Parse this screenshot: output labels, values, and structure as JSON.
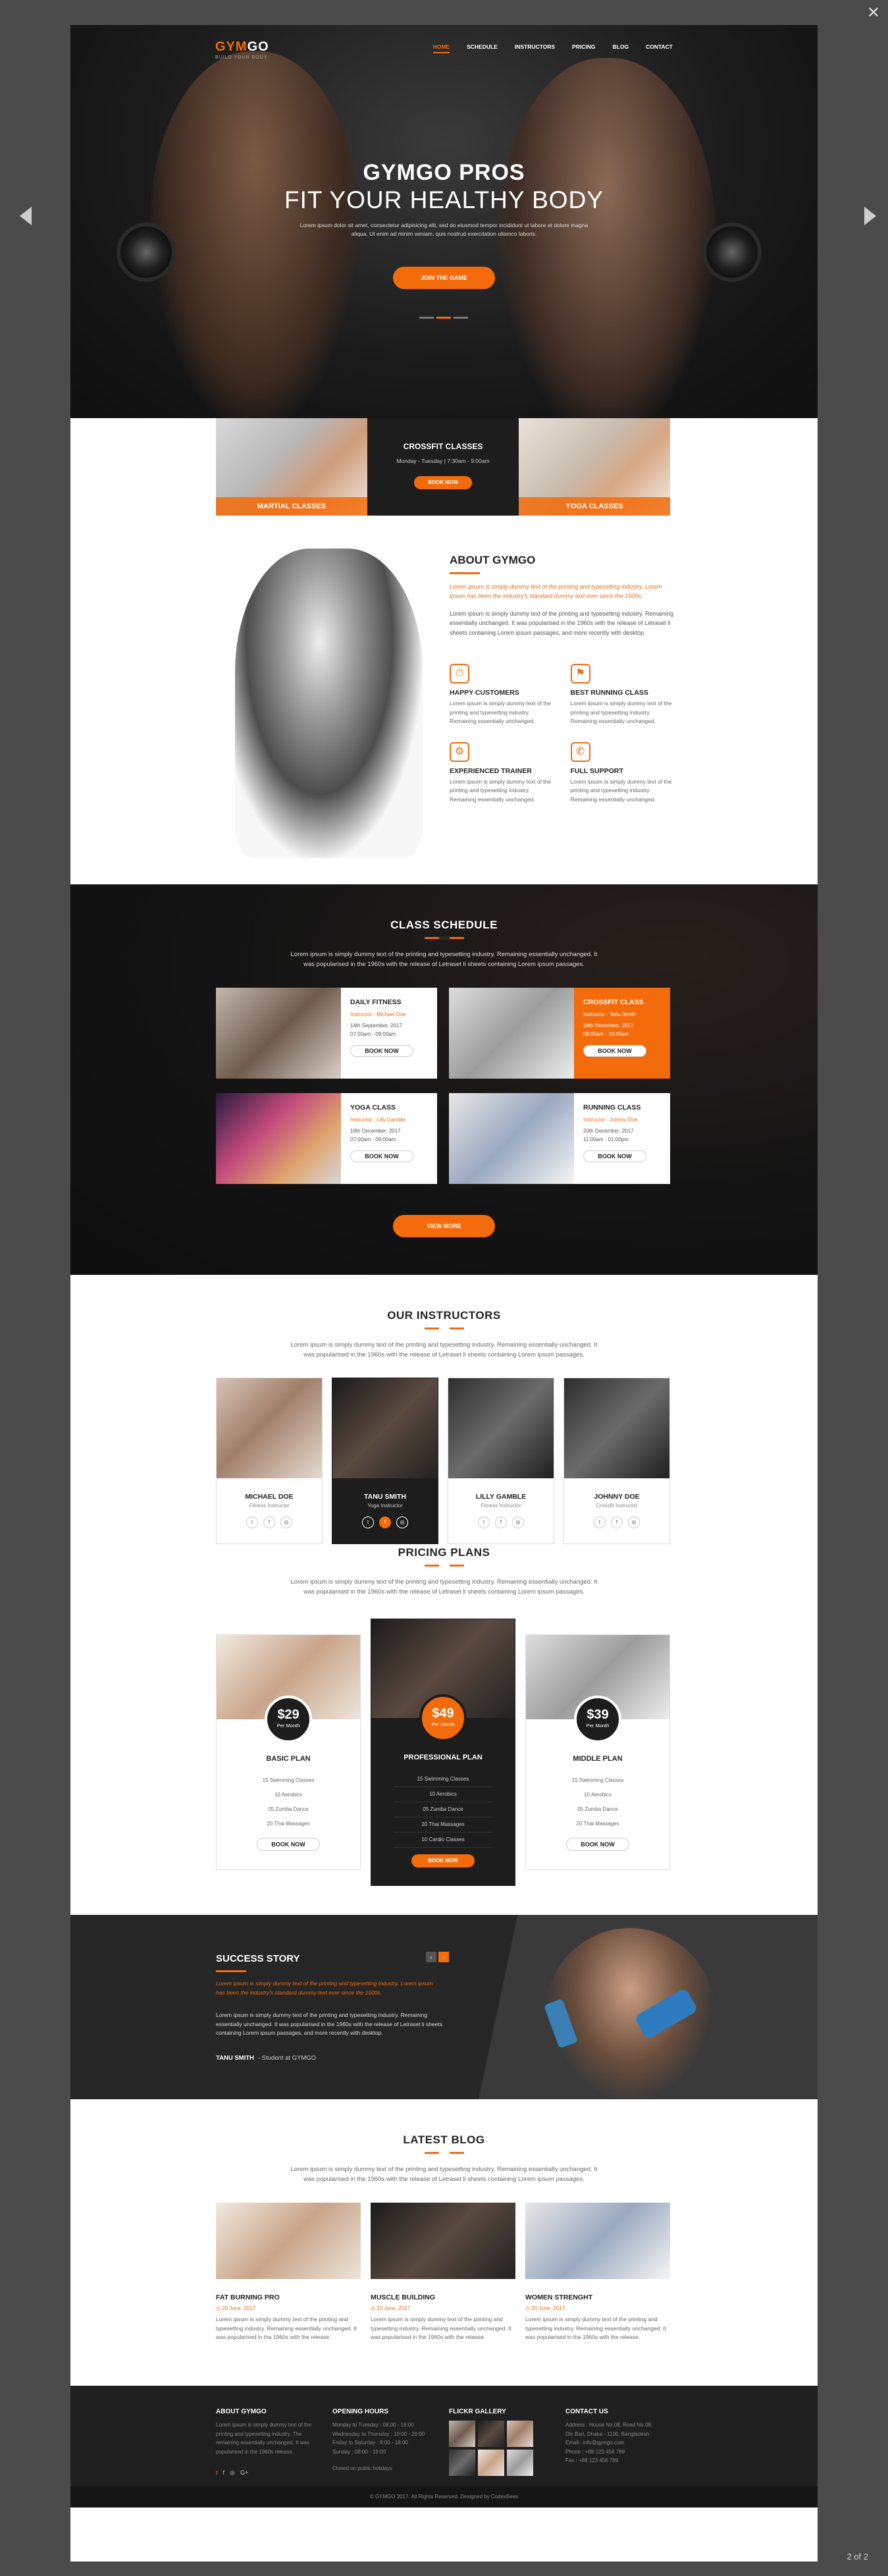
{
  "viewer": {
    "close_icon": "close-icon",
    "prev_icon": "chevron-left-icon",
    "next_icon": "chevron-right-icon",
    "counter": "2 of 2"
  },
  "nav": {
    "logo_main": "GYM",
    "logo_accent": "GO",
    "tagline": "BUILD YOUR BODY",
    "items": [
      "HOME",
      "SCHEDULE",
      "INSTRUCTORS",
      "PRICING",
      "BLOG",
      "CONTACT"
    ],
    "active": "HOME"
  },
  "hero": {
    "title": "GYMGO PROS",
    "subtitle": "FIT YOUR HEALTHY BODY",
    "desc": "Lorem ipsum dolor sit amet, consectetur adipisicing elit, sed do eiusmod tempor incididunt ut labore et dolore magna aliqua. Ut enim ad minim veniam, quis nostrud exercitation ullamco laboris.",
    "button": "JOIN THE GAME"
  },
  "classes": {
    "left": "MARTIAL CLASSES",
    "center_title": "CROSSFIT CLASSES",
    "center_time": "Monday - Tuesday | 7:30am - 9:00am",
    "center_button": "BOOK NOW",
    "right": "YOGA CLASSES"
  },
  "about": {
    "title": "ABOUT GYMGO",
    "lead": "Lorem ipsum is simply dummy text of the printing and typesetting industry. Lorem ipsum has been the industry's standard dummy text ever since the 1500s.",
    "body": "Lorem ipsum is simply dummy text of the printing and typesetting industry. Remaining essentially unchanged. It was popularised in the 1960s with the release of Letraset li sheets containing Lorem ipsum passages, and more recently with desktop.",
    "features": [
      {
        "icon": "stopwatch-icon",
        "title": "HAPPY CUSTOMERS",
        "desc": "Lorem ipsum is simply dummy text of the printing and typesetting industry. Remaining essentially unchanged."
      },
      {
        "icon": "treadmill-icon",
        "title": "BEST RUNNING CLASS",
        "desc": "Lorem ipsum is simply dummy text of the printing and typesetting industry. Remaining essentially unchanged."
      },
      {
        "icon": "bike-icon",
        "title": "EXPERIENCED TRAINER",
        "desc": "Lorem ipsum is simply dummy text of the printing and typesetting industry. Remaining essentially unchanged."
      },
      {
        "icon": "support-icon",
        "title": "FULL SUPPORT",
        "desc": "Lorem ipsum is simply dummy text of the printing and typesetting industry. Remaining essentially unchanged."
      }
    ]
  },
  "schedule": {
    "title": "CLASS SCHEDULE",
    "desc": "Lorem ipsum is simply dummy text of the printing and typesetting industry. Remaining essentially unchanged. It was popularised in the 1960s with the release of Letraset li sheets containing Lorem ipsum passages.",
    "cards": [
      {
        "title": "DAILY FITNESS",
        "instructor": "Instructor : Michael Doe",
        "date": "14th September, 2017",
        "time": "07:00am - 09:00am",
        "button": "BOOK NOW"
      },
      {
        "title": "CROSSFIT CLASS",
        "instructor": "Instructor : Tanu Smith",
        "date": "18th November, 2017",
        "time": "08:00am - 10:00am",
        "button": "BOOK NOW"
      },
      {
        "title": "YOGA CLASS",
        "instructor": "Instructor : Lilly Gamble",
        "date": "19th December, 2017",
        "time": "07:00am - 09:00am",
        "button": "BOOK NOW"
      },
      {
        "title": "RUNNING CLASS",
        "instructor": "Instructor : Johnny Doe",
        "date": "20th December, 2017",
        "time": "11:00am - 01:00pm",
        "button": "BOOK NOW"
      }
    ],
    "button": "VIEW MORE"
  },
  "instructors": {
    "title": "OUR INSTRUCTORS",
    "desc": "Lorem ipsum is simply dummy text of the printing and typesetting industry. Remaining essentially unchanged. It was popularised in the 1960s with the release of Letraset li sheets containing Lorem ipsum passages.",
    "list": [
      {
        "name": "MICHAEL DOE",
        "role": "Fitness Instructor"
      },
      {
        "name": "TANU SMITH",
        "role": "Yoga Instructor"
      },
      {
        "name": "LILLY GAMBLE",
        "role": "Fitness Instructor"
      },
      {
        "name": "JOHNNY DOE",
        "role": "Crossfit Instructor"
      }
    ],
    "social": [
      "t",
      "f",
      "◎"
    ]
  },
  "pricing": {
    "title": "PRICING PLANS",
    "desc": "Lorem ipsum is simply dummy text of the printing and typesetting industry. Remaining essentially unchanged. It was popularised in the 1960s with the release of Letraset li sheets containing Lorem ipsum passages.",
    "plans": [
      {
        "price": "$29",
        "period": "Per Month",
        "name": "BASIC PLAN",
        "items": [
          "15 Swimming Classes",
          "10 Aerobics",
          "05 Zumba Dance",
          "20 Thai Massages"
        ],
        "button": "BOOK NOW"
      },
      {
        "price": "$49",
        "period": "Per Month",
        "name": "PROFESSIONAL PLAN",
        "items": [
          "15 Swimming Classes",
          "10 Aerobics",
          "05 Zumba Dance",
          "20 Thai Massages",
          "10 Cardio Classes"
        ],
        "button": "BOOK NOW"
      },
      {
        "price": "$39",
        "period": "Per Month",
        "name": "MIDDLE PLAN",
        "items": [
          "15 Swimming Classes",
          "10 Aerobics",
          "05 Zumba Dance",
          "20 Thai Massages"
        ],
        "button": "BOOK NOW"
      }
    ]
  },
  "success": {
    "title": "SUCCESS STORY",
    "prev": "‹",
    "next": "›",
    "lead": "Lorem ipsum is simply dummy text of the printing and typesetting industry. Lorem ipsum has been the industry's standard dummy text ever since the 1500s.",
    "body": "Lorem ipsum is simply dummy text of the printing and typesetting industry. Remaining essentially unchanged. It was popularised in the 1960s with the release of Letraset li sheets containing Lorem ipsum passages, and more recently with desktop.",
    "name": "TANU SMITH",
    "role": "- Student at GYMGO"
  },
  "blog": {
    "title": "LATEST BLOG",
    "desc": "Lorem ipsum is simply dummy text of the printing and typesetting industry. Remaining essentially unchanged. It was popularised in the 1960s with the release of Letraset li sheets containing Lorem ipsum passages.",
    "posts": [
      {
        "title": "FAT BURNING PRO",
        "date": "20 June, 2017",
        "desc": "Lorem ipsum is simply dummy text of the printing and typesetting industry. Remaining essentially unchanged. It was popularised in the 1960s with the release."
      },
      {
        "title": "MUSCLE BUILDING",
        "date": "20 June, 2017",
        "desc": "Lorem ipsum is simply dummy text of the printing and typesetting industry. Remaining essentially unchanged. It was popularised in the 1960s with the release."
      },
      {
        "title": "WOMEN STRENGHT",
        "date": "20 June, 2017",
        "desc": "Lorem ipsum is simply dummy text of the printing and typesetting industry. Remaining essentially unchanged. It was popularised in the 1960s with the release."
      }
    ]
  },
  "footer": {
    "about_title": "ABOUT GYMGO",
    "about_desc": "Lorem ipsum is simply dummy text of the printing and typesetting industry. The remaining essentially unchanged. It was popularised in the 1960s release.",
    "hours_title": "OPENING HOURS",
    "hours": [
      "Monday to Tuesday : 08:00 - 19:00",
      "Wednesday to Thursday : 10:00 - 20:00",
      "Friday to Saturday : 9:00 - 18:00",
      "Sunday : 08:00 - 19:00",
      "",
      "Closed on public holidays"
    ],
    "flickr_title": "FLICKR GALLERY",
    "contact_title": "CONTACT US",
    "contact": [
      "Address : House No.08, Road No.08,",
      "Din Bari, Dhaka - 1100, Bangladesh",
      "Email : info@gymgo.com",
      "Phone : +88 123 456 789",
      "Fax : +88 123 456 789"
    ],
    "social": [
      "t",
      "f",
      "◎",
      "G+"
    ],
    "copyright_brand": "GYMGO",
    "copyright": "© GYMGO 2017. All Rights Reserved. Designed by CodexBees"
  }
}
